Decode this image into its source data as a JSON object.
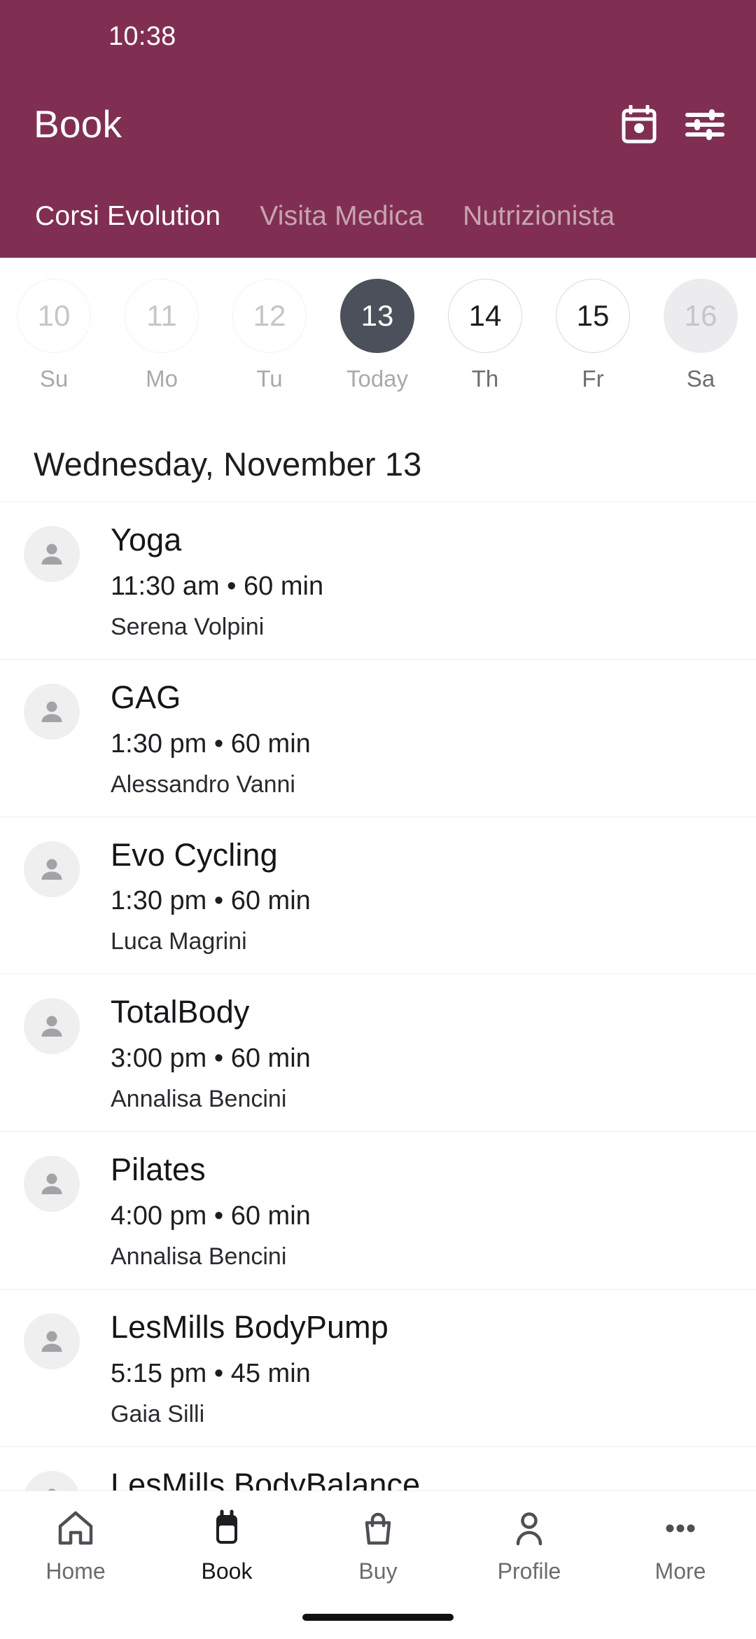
{
  "theme": {
    "brand_maroon": "#802F52",
    "selected_day_bg": "#4C505A",
    "page_bg": "#FFFFFF",
    "divider": "#EEEEEF",
    "muted_text": "#A9A9AD"
  },
  "status_bar": {
    "time": "10:38"
  },
  "app_bar": {
    "title": "Book",
    "actions": [
      {
        "name": "calendar-icon",
        "label": "Calendar"
      },
      {
        "name": "filter-icon",
        "label": "Filters"
      }
    ]
  },
  "tabs": [
    {
      "label": "Corsi Evolution",
      "active": true
    },
    {
      "label": "Visita Medica",
      "active": false
    },
    {
      "label": "Nutrizionista",
      "active": false
    }
  ],
  "date_strip": {
    "days": [
      {
        "number": "10",
        "weekday": "Su",
        "state": "past"
      },
      {
        "number": "11",
        "weekday": "Mo",
        "state": "past"
      },
      {
        "number": "12",
        "weekday": "Tu",
        "state": "past"
      },
      {
        "number": "13",
        "weekday": "Today",
        "state": "selected"
      },
      {
        "number": "14",
        "weekday": "Th",
        "state": "future"
      },
      {
        "number": "15",
        "weekday": "Fr",
        "state": "future"
      },
      {
        "number": "16",
        "weekday": "Sa",
        "state": "pressed"
      }
    ]
  },
  "schedule": {
    "section_date": "Wednesday, November 13",
    "classes": [
      {
        "title": "Yoga",
        "meta": "11:30 am • 60 min",
        "instructor": "Serena Volpini"
      },
      {
        "title": "GAG",
        "meta": "1:30 pm • 60 min",
        "instructor": "Alessandro Vanni"
      },
      {
        "title": "Evo Cycling",
        "meta": "1:30 pm • 60 min",
        "instructor": "Luca Magrini"
      },
      {
        "title": "TotalBody",
        "meta": "3:00 pm • 60 min",
        "instructor": "Annalisa Bencini"
      },
      {
        "title": "Pilates",
        "meta": "4:00 pm • 60 min",
        "instructor": "Annalisa Bencini"
      },
      {
        "title": "LesMills BodyPump",
        "meta": "5:15 pm • 45 min",
        "instructor": "Gaia Silli"
      },
      {
        "title": "LesMills BodyBalance",
        "meta": "",
        "instructor": ""
      }
    ]
  },
  "bottom_nav": [
    {
      "label": "Home",
      "icon": "home-icon",
      "active": false
    },
    {
      "label": "Book",
      "icon": "calendar-filled-icon",
      "active": true
    },
    {
      "label": "Buy",
      "icon": "shopping-bag-icon",
      "active": false
    },
    {
      "label": "Profile",
      "icon": "person-icon",
      "active": false
    },
    {
      "label": "More",
      "icon": "more-dots-icon",
      "active": false
    }
  ]
}
